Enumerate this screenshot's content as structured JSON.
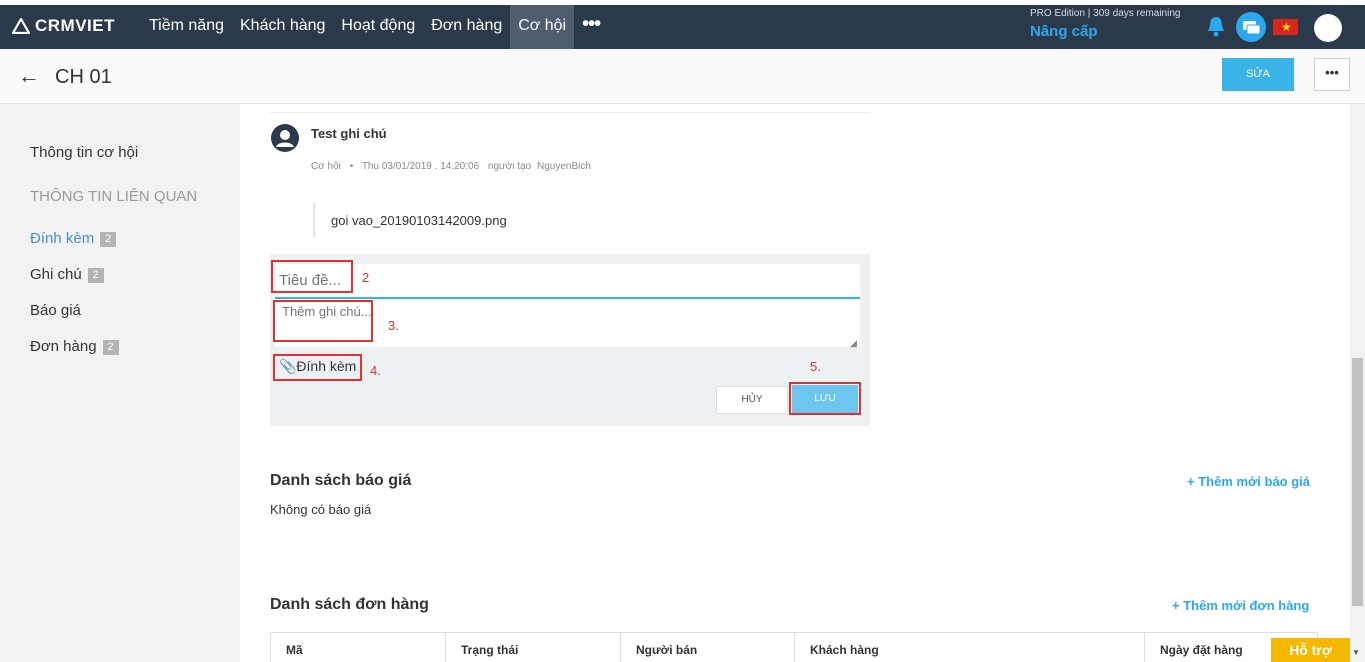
{
  "nav": {
    "logo": "CRMVIET",
    "items": [
      {
        "label": "Tiềm năng",
        "active": false
      },
      {
        "label": "Khách hàng",
        "active": false
      },
      {
        "label": "Hoạt động",
        "active": false
      },
      {
        "label": "Đơn hàng",
        "active": false
      },
      {
        "label": "Cơ hội",
        "active": true
      }
    ],
    "more": "•••",
    "edition": "PRO Edition | 309 days remaining",
    "upgrade": "Nâng cấp"
  },
  "header": {
    "back_icon": "←",
    "title": "CH 01",
    "edit_label": "SỬA",
    "more_label": "•••"
  },
  "sidebar": {
    "info": "Thông tin cơ hội",
    "related_heading": "THÔNG TIN LIÊN QUAN",
    "items": [
      {
        "label": "Đính kèm",
        "badge": "2"
      },
      {
        "label": "Ghi chú",
        "badge": "2"
      },
      {
        "label": "Báo giá",
        "badge": ""
      },
      {
        "label": "Đơn hàng",
        "badge": "2"
      }
    ]
  },
  "note": {
    "title": "Test ghi chú",
    "type": "Cơ hội",
    "bullet": "•",
    "date": "Thu 03/01/2019 . 14:20:06",
    "creator_label": "người tạo",
    "creator": "NguyenBich",
    "attachment": "goi vao_20190103142009.png"
  },
  "form": {
    "title_placeholder": "Tiêu đề...",
    "note_placeholder": "Thêm ghi chú...",
    "attach_label": "📎Đính kèm",
    "cancel_label": "HỦY",
    "save_label": "LƯU",
    "steps": [
      "2",
      "3.",
      "4.",
      "5."
    ]
  },
  "quotes": {
    "title": "Danh sách báo giá",
    "add_label": "+ Thêm mới báo giá",
    "empty": "Không có báo giá"
  },
  "orders": {
    "title": "Danh sách đơn hàng",
    "add_label": "+ Thêm mới đơn hàng",
    "columns": [
      "Mã",
      "Trạng thái",
      "Người bán",
      "Khách hàng",
      "Ngày đặt hàng"
    ]
  },
  "help": {
    "label": "Hỗ trợ"
  }
}
